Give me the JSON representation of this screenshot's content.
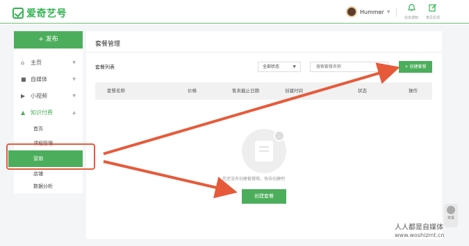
{
  "header": {
    "logo_text": "爱奇艺号",
    "username": "Hummer",
    "notifications_label": "信息通知",
    "feedback_label": "意见反馈"
  },
  "sidebar": {
    "publish_label": "+ 发布",
    "items": [
      {
        "label": "主页",
        "icon": "home-icon"
      },
      {
        "label": "自媒体",
        "icon": "media-icon"
      },
      {
        "label": "小视频",
        "icon": "video-icon"
      },
      {
        "label": "知识付费",
        "icon": "graduation-cap-icon"
      }
    ],
    "sub_items": [
      "首页",
      "课程管理",
      "营销",
      "店铺",
      "数据分析"
    ],
    "selected": "营销"
  },
  "main": {
    "title": "套餐管理",
    "list_title": "套餐列表",
    "status_filter": "全部状态",
    "search_placeholder": "搜索套餐名称",
    "create_top_label": "+ 创建套餐",
    "columns": [
      "套餐名称",
      "价格",
      "售卖截止日期",
      "创建时间",
      "状态",
      "操作"
    ],
    "empty_text": "您还没有创建套餐哦，快去创建吧",
    "create_center_label": "创建套餐"
  },
  "annotations": {
    "color": "#e65a3a"
  },
  "float_label": "举报",
  "watermark": {
    "text": "人人都是自媒体",
    "url": "www.woshizmt.cn"
  },
  "colors": {
    "brand": "#2fb34f",
    "button": "#4cae5c"
  }
}
